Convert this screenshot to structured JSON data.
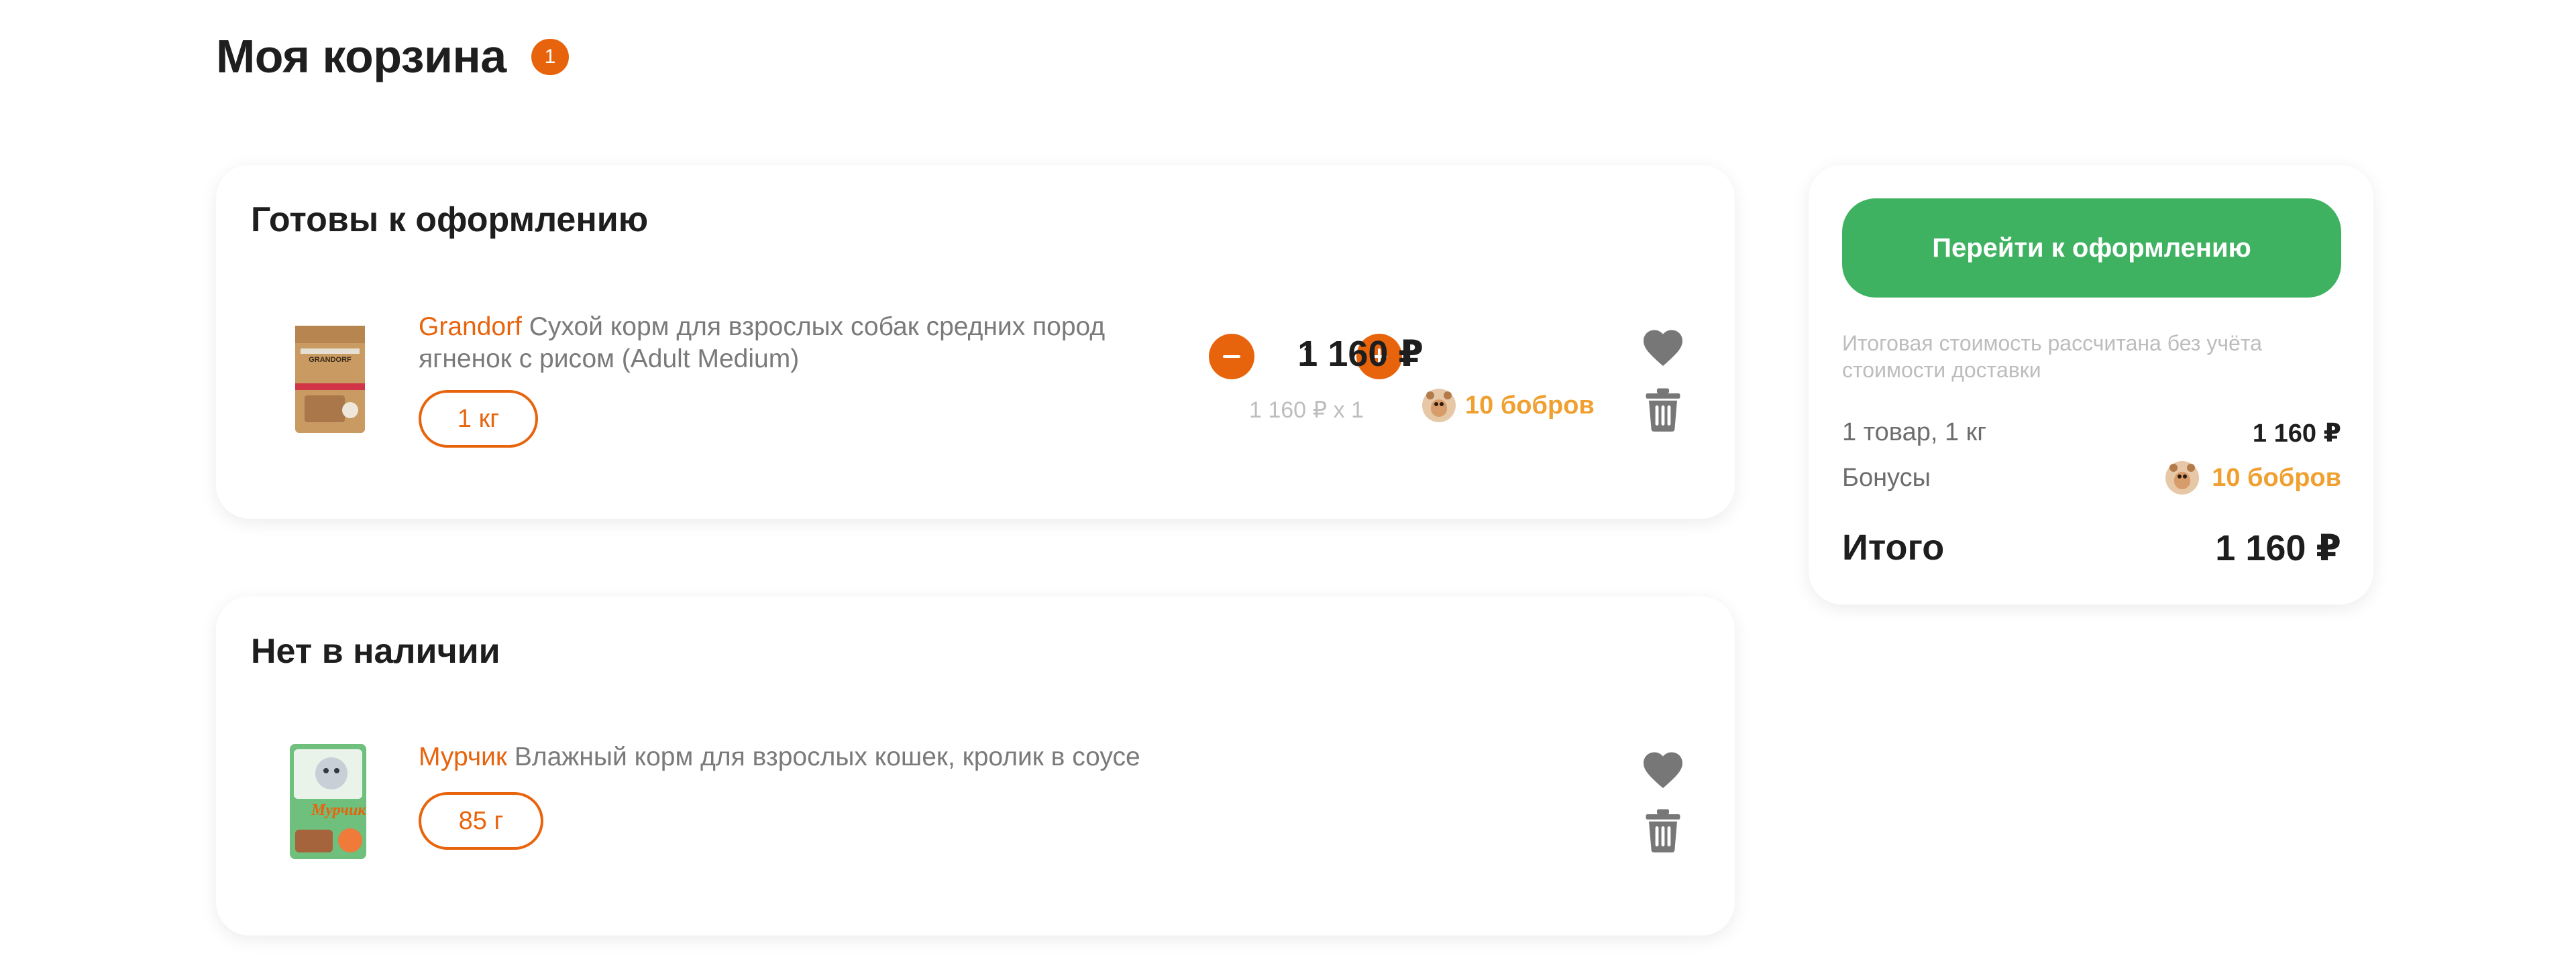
{
  "header": {
    "title": "Моя корзина",
    "badge_count": "1"
  },
  "ready_section": {
    "title": "Готовы к оформлению",
    "item": {
      "brand": "Grandorf",
      "name": "Сухой корм для взрослых собак средних пород ягненок с рисом (Adult Medium)",
      "variant": "1 кг",
      "quantity": "1",
      "price": "1 160 ₽",
      "unit_price": "1 160 ₽ х 1",
      "bonus": "10 бобров"
    }
  },
  "out_of_stock_section": {
    "title": "Нет в наличии",
    "item": {
      "brand": "Мурчик",
      "name": "Влажный корм для взрослых кошек, кролик в соусе",
      "variant": "85 г"
    }
  },
  "summary": {
    "checkout_label": "Перейти к оформлению",
    "note": "Итоговая стоимость рассчитана без учёта стоимости доставки",
    "goods_label": "1 товар, 1 кг",
    "goods_value": "1 160 ₽",
    "bonus_label": "Бонусы",
    "bonus_value": "10 бобров",
    "total_label": "Итого",
    "total_value": "1 160 ₽"
  },
  "icons": {
    "minus": "minus-icon",
    "plus": "plus-icon",
    "favorite": "heart-icon",
    "delete": "trash-icon",
    "bonus": "beaver-icon"
  },
  "colors": {
    "accent": "#e8640c",
    "cta": "#3fb262",
    "bonus": "#f0a030",
    "muted": "#bdbdbd"
  }
}
